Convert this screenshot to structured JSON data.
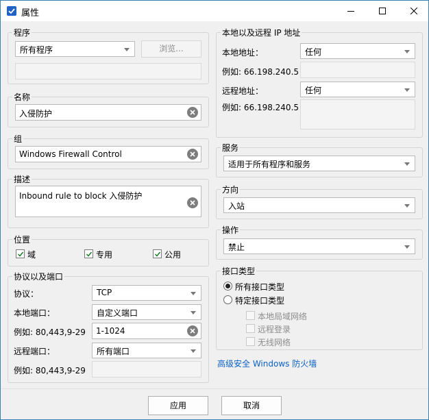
{
  "window": {
    "title": "属性"
  },
  "program": {
    "legend": "程序",
    "combo_value": "所有程序",
    "browse_label": "浏览..."
  },
  "name": {
    "legend": "名称",
    "value": "入侵防护"
  },
  "group": {
    "legend": "组",
    "value": "Windows Firewall Control"
  },
  "description": {
    "legend": "描述",
    "value": "Inbound rule to block 入侵防护"
  },
  "location": {
    "legend": "位置",
    "options": [
      {
        "label": "域",
        "checked": true
      },
      {
        "label": "专用",
        "checked": true
      },
      {
        "label": "公用",
        "checked": true
      }
    ]
  },
  "protocol_ports": {
    "legend": "协议以及端口",
    "protocol_label": "协议：",
    "protocol_value": "TCP",
    "local_port_label": "本地端口：",
    "local_port_value": "自定义端口",
    "local_example_label": "例如: 80,443,9-29",
    "local_port_text": "1-1024",
    "remote_port_label": "远程端口：",
    "remote_port_value": "所有端口",
    "remote_example_label": "例如: 80,443,9-29",
    "remote_port_text": ""
  },
  "addresses": {
    "legend": "本地以及远程 IP 地址",
    "local_label": "本地地址：",
    "local_value": "任何",
    "local_example": "例如: 66.198.240.5",
    "remote_label": "远程地址：",
    "remote_value": "任何",
    "remote_example": "例如: 66.198.240.5"
  },
  "service": {
    "legend": "服务",
    "value": "适用于所有程序和服务"
  },
  "direction": {
    "legend": "方向",
    "value": "入站"
  },
  "action": {
    "legend": "操作",
    "value": "禁止"
  },
  "interface": {
    "legend": "接口类型",
    "all_label": "所有接口类型",
    "specific_label": "特定接口类型",
    "selected": "all",
    "specific_options": [
      {
        "label": "本地局域网络",
        "checked": false
      },
      {
        "label": "远程登录",
        "checked": false
      },
      {
        "label": "无线网络",
        "checked": false
      }
    ]
  },
  "advanced_link": "高级安全 Windows 防火墙",
  "footer": {
    "apply_label": "应用",
    "cancel_label": "取消"
  },
  "colors": {
    "accent": "#1f63c7",
    "link": "#0b61c7",
    "window_border": "#3c7fb1"
  }
}
